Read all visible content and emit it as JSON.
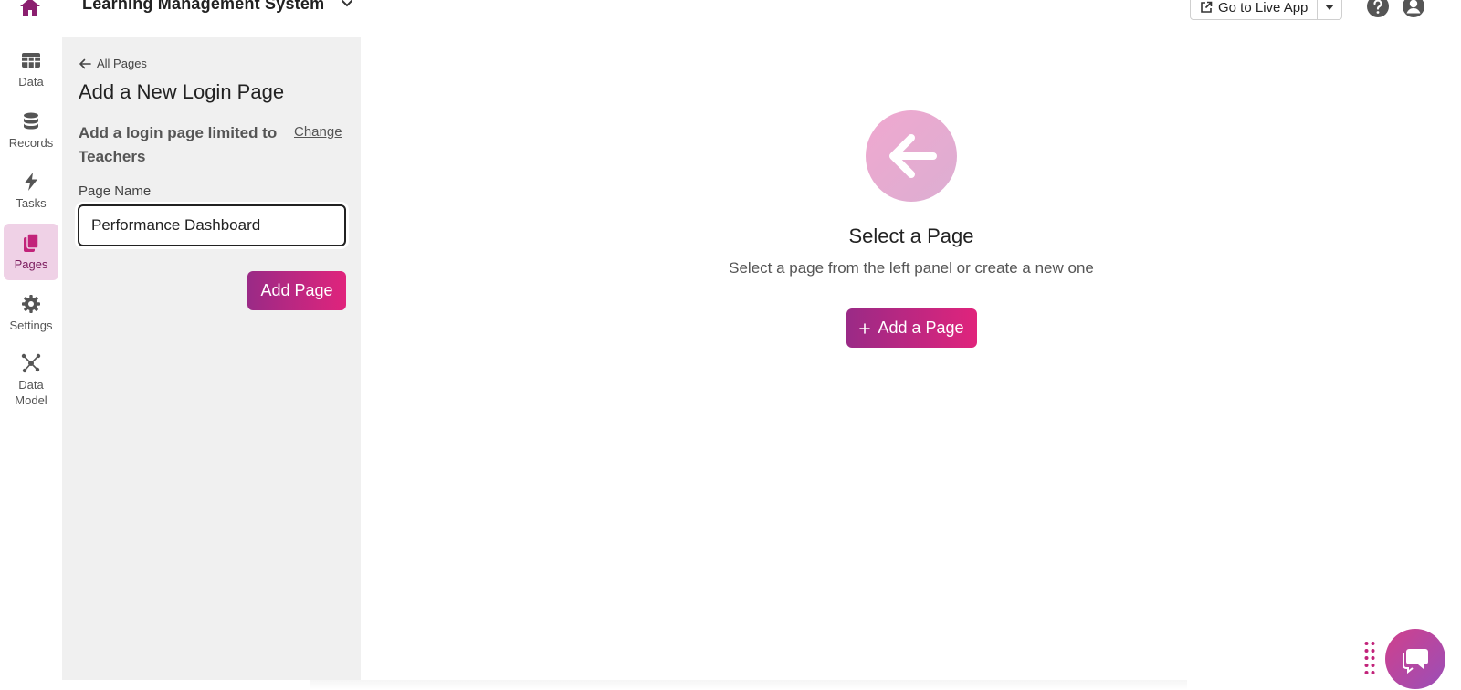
{
  "header": {
    "app_title": "Learning Management System",
    "go_live_label": "Go to Live App"
  },
  "nav": {
    "items": [
      {
        "label": "Data",
        "icon": "table-icon"
      },
      {
        "label": "Records",
        "icon": "database-icon"
      },
      {
        "label": "Tasks",
        "icon": "lightning-icon"
      },
      {
        "label": "Pages",
        "icon": "pages-icon",
        "active": true
      },
      {
        "label": "Settings",
        "icon": "gear-icon"
      },
      {
        "label": "Data Model",
        "icon": "network-icon"
      }
    ]
  },
  "panel": {
    "back_label": "All Pages",
    "title": "Add a New Login Page",
    "limit_text": "Add a login page limited to",
    "limit_role": "Teachers",
    "change_label": "Change",
    "field_label": "Page Name",
    "page_name_value": "Performance Dashboard",
    "submit_label": "Add Page"
  },
  "main": {
    "empty_title": "Select a Page",
    "empty_subtitle": "Select a page from the left panel or create a new one",
    "add_button_label": "Add a Page"
  },
  "colors": {
    "accent": "#c2237a",
    "accent_gradient_start": "#9a2a86",
    "accent_gradient_end": "#e0247c",
    "nav_active_bg": "#efd1e6",
    "panel_bg": "#f0f0f0"
  }
}
